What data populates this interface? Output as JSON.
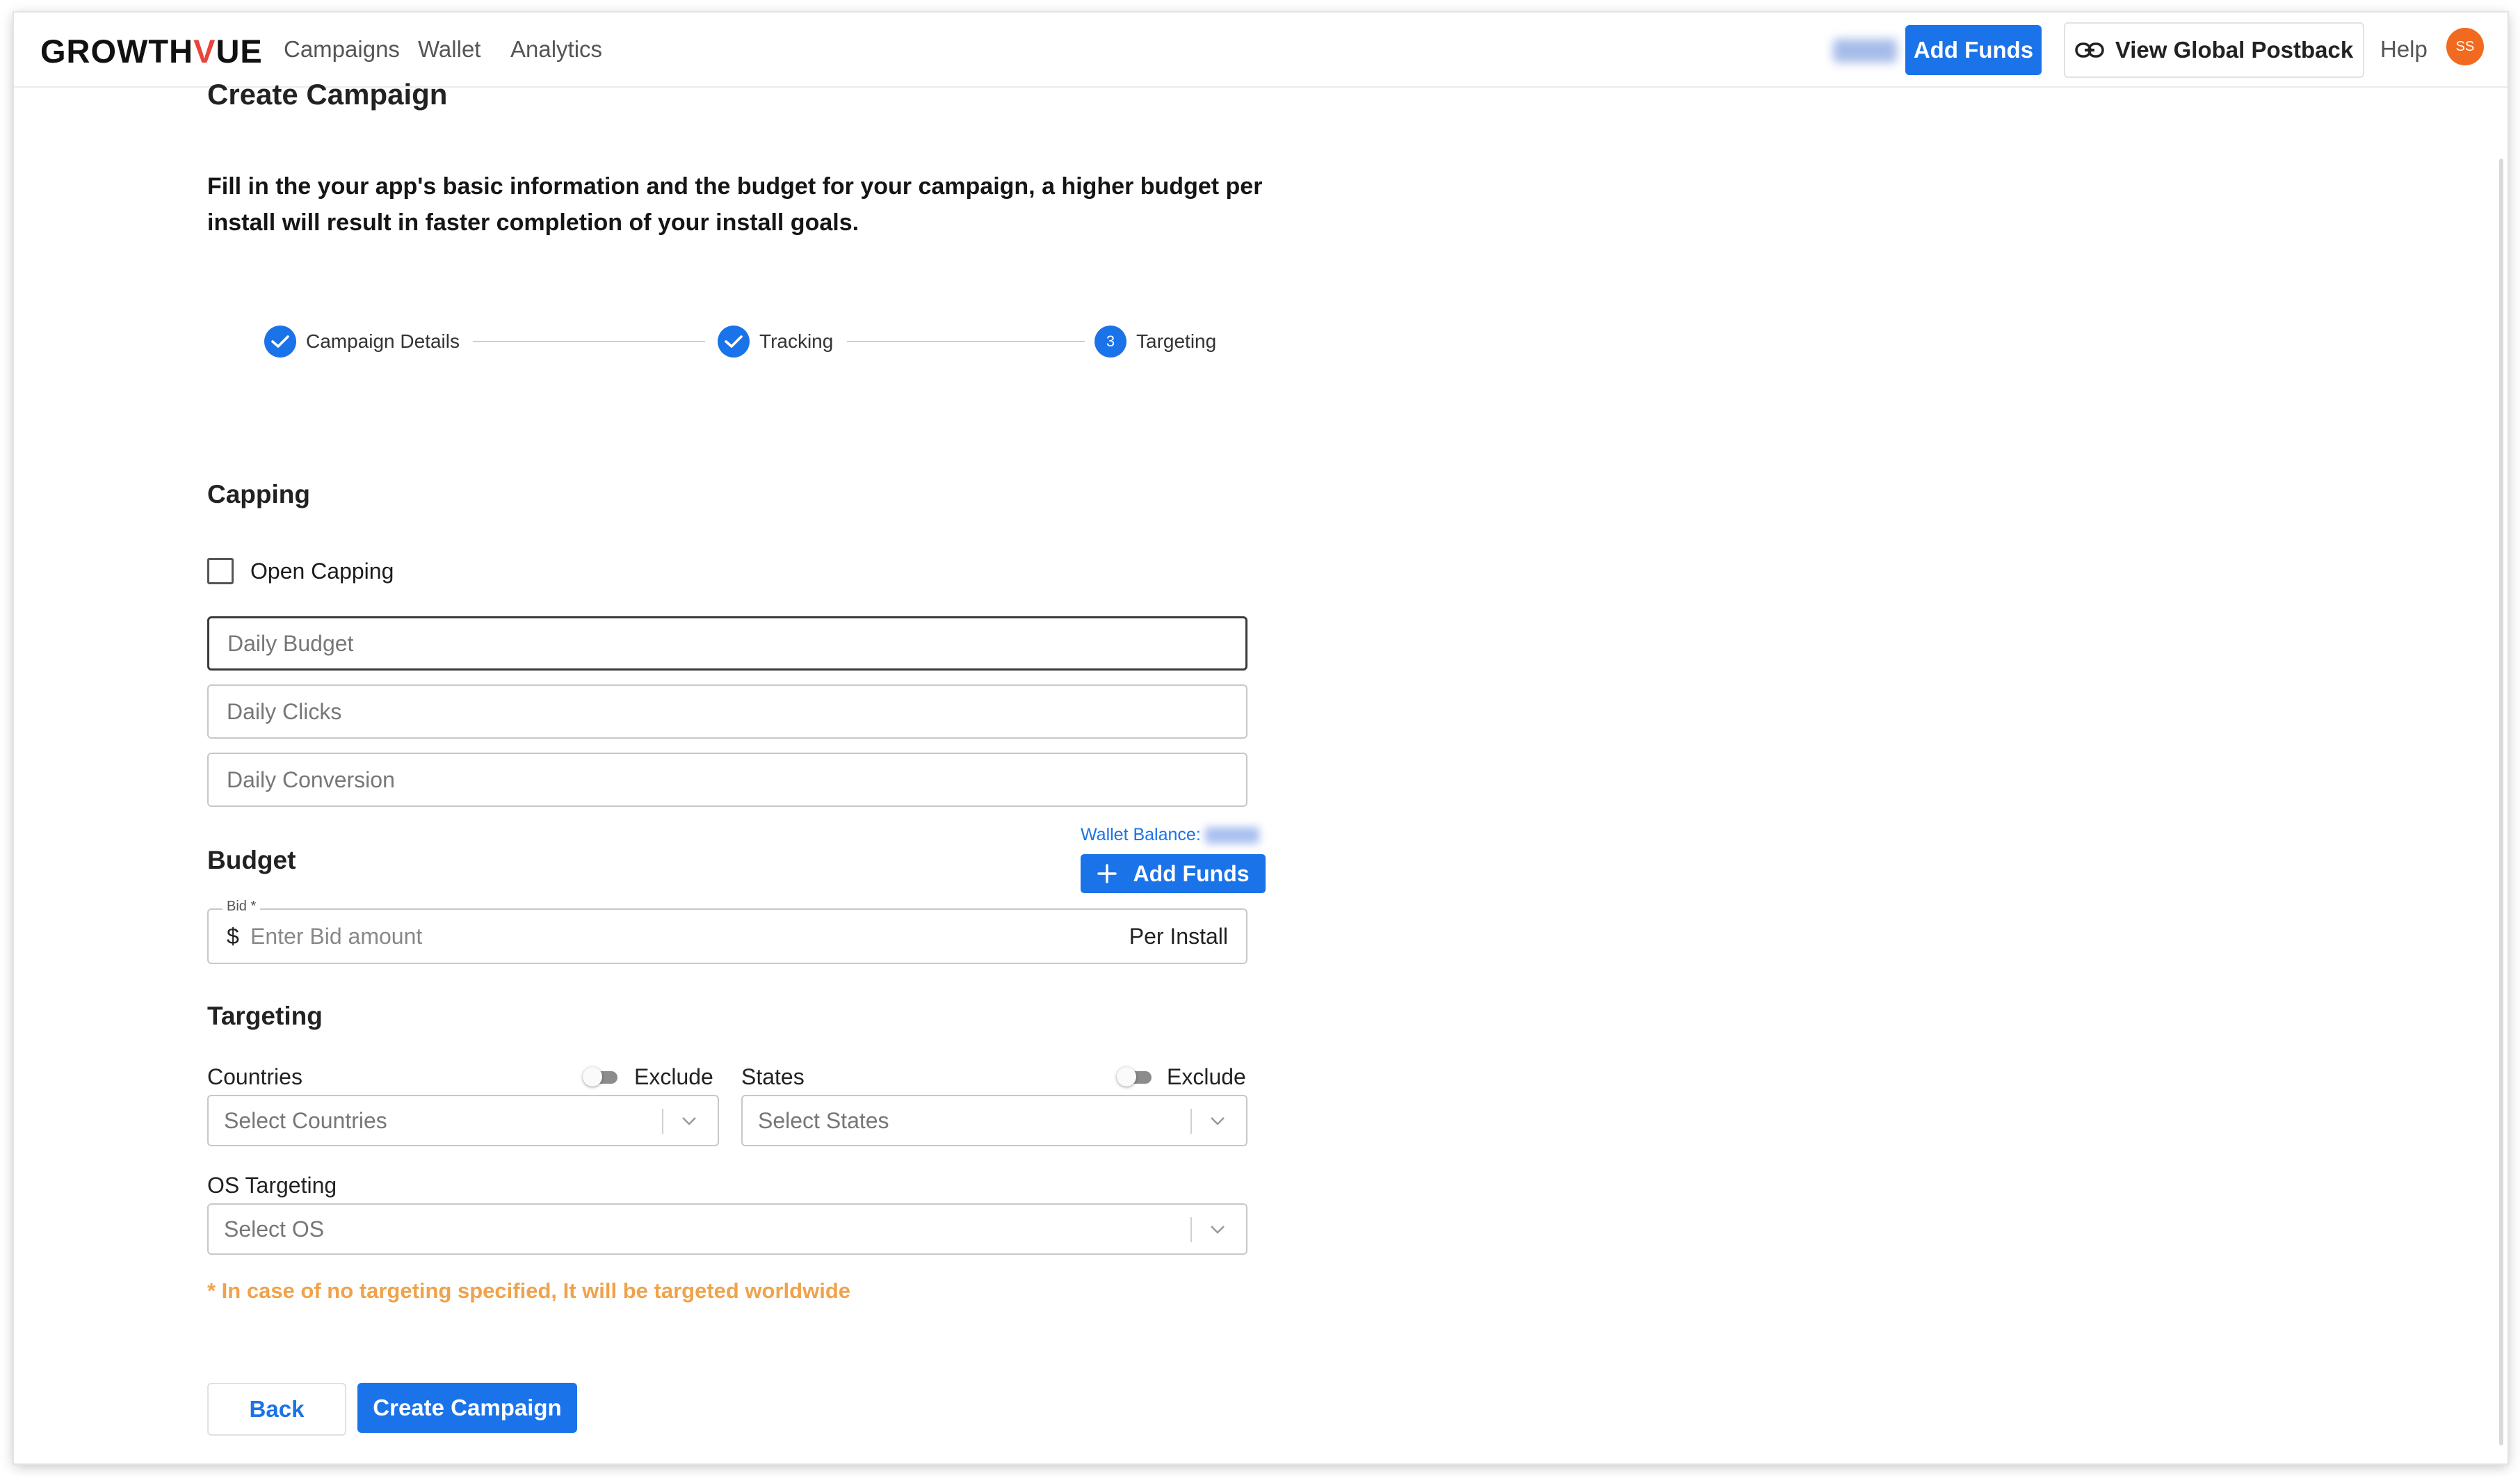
{
  "brand": {
    "logo_prefix": "GROWTH",
    "logo_v": "V",
    "logo_suffix": "UE"
  },
  "nav": {
    "items": [
      "Campaigns",
      "Wallet",
      "Analytics"
    ]
  },
  "header": {
    "add_funds": "Add Funds",
    "postback": "View Global Postback",
    "help": "Help",
    "avatar_initials": "SS"
  },
  "page": {
    "title": "Create Campaign",
    "intro": "Fill in the your app's basic information and the budget for your campaign, a higher budget per install will result in faster completion of your install goals."
  },
  "stepper": {
    "steps": [
      {
        "label": "Campaign Details",
        "state": "done"
      },
      {
        "label": "Tracking",
        "state": "done"
      },
      {
        "label": "Targeting",
        "state": "current",
        "number": "3"
      }
    ]
  },
  "capping": {
    "heading": "Capping",
    "open_capping_label": "Open Capping",
    "daily_budget_placeholder": "Daily Budget",
    "daily_clicks_placeholder": "Daily Clicks",
    "daily_conversion_placeholder": "Daily Conversion"
  },
  "budget": {
    "heading": "Budget",
    "wallet_label": "Wallet Balance:",
    "add_funds": "Add Funds",
    "bid_label": "Bid *",
    "currency": "$",
    "bid_placeholder": "Enter Bid amount",
    "suffix": "Per Install"
  },
  "targeting": {
    "heading": "Targeting",
    "countries_label": "Countries",
    "states_label": "States",
    "exclude": "Exclude",
    "countries_placeholder": "Select Countries",
    "states_placeholder": "Select States",
    "os_label": "OS Targeting",
    "os_placeholder": "Select OS",
    "note": "* In case of no targeting specified, It will be targeted worldwide"
  },
  "actions": {
    "back": "Back",
    "create": "Create Campaign"
  },
  "colors": {
    "primary": "#1a73e8",
    "note": "#f0a24a",
    "avatar": "#f16a1f",
    "logo_v": "#e8443a"
  }
}
